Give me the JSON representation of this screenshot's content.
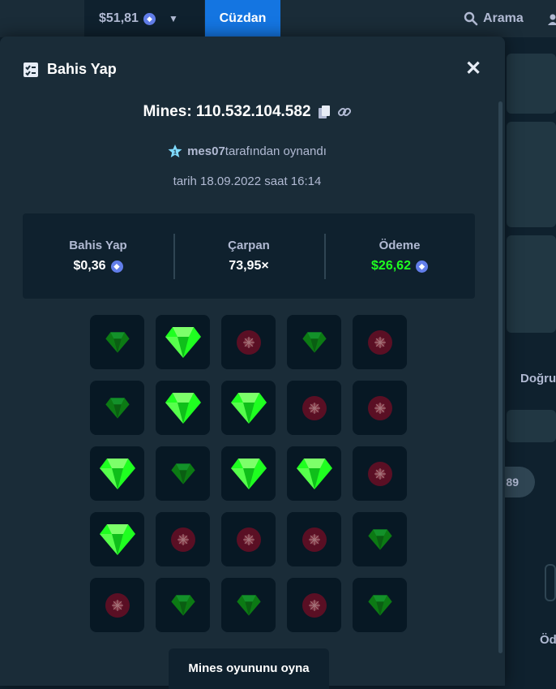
{
  "topbar": {
    "balance": "$51,81",
    "wallet_label": "Cüzdan",
    "search_label": "Arama"
  },
  "background": {
    "right_text_1": "Doğru",
    "pill_value": "89",
    "right_text_2": "Öd"
  },
  "modal": {
    "title": "Bahis Yap",
    "game_label": "Mines: 110.532.104.582",
    "player_name": "mes07",
    "played_by_suffix": "tarafından oynandı",
    "date_line": "tarih 18.09.2022 saat 16:14",
    "stats": [
      {
        "label": "Bahis Yap",
        "value": "$0,36",
        "coin": true,
        "color": "#ffffff"
      },
      {
        "label": "Çarpan",
        "value": "73,95×",
        "coin": false,
        "color": "#ffffff"
      },
      {
        "label": "Ödeme",
        "value": "$26,62",
        "coin": true,
        "color": "#1fff20"
      }
    ],
    "play_button": "Mines oyununu oyna"
  },
  "colors": {
    "bg": "#0f212e",
    "panel": "#1a2c38",
    "accent_blue": "#1475e1",
    "gem_bright": "#1fff20",
    "gem_dim": "#0c7a14",
    "mine": "#5a0f24"
  },
  "board": [
    [
      "gem-dim",
      "gem",
      "mine",
      "gem-dim",
      "mine"
    ],
    [
      "gem-dim",
      "gem",
      "gem",
      "mine",
      "mine"
    ],
    [
      "gem",
      "gem-dim",
      "gem",
      "gem",
      "mine"
    ],
    [
      "gem",
      "mine",
      "mine",
      "mine",
      "gem-dim"
    ],
    [
      "mine",
      "gem-dim",
      "gem-dim",
      "mine",
      "gem-dim"
    ]
  ]
}
